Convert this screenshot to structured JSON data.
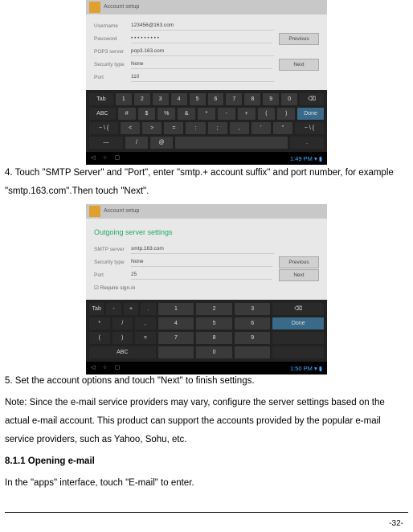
{
  "shot1": {
    "title": "Account setup",
    "labels": {
      "u": "Username",
      "p": "Password",
      "s": "POP3 server",
      "t": "Security type",
      "pt": "Port"
    },
    "vals": {
      "u": "123456@163.com",
      "p": "• • • • • • • • •",
      "s": "pop3.163.com",
      "t": "None",
      "pt": "110"
    },
    "btns": {
      "prev": "Previous",
      "next": "Next"
    },
    "kbd": {
      "r1": [
        "Tab",
        "1",
        "2",
        "3",
        "4",
        "5",
        "6",
        "7",
        "8",
        "9",
        "0",
        "⌫"
      ],
      "r2": [
        "ABC",
        "#",
        "$",
        "%",
        "&",
        "*",
        "-",
        "+",
        "(",
        ")",
        "Done"
      ],
      "r3": [
        "~ \\ {",
        "<",
        ">",
        "=",
        ":",
        ";",
        ",",
        "'",
        "\"",
        "~ \\ {"
      ],
      "r4": [
        "/",
        "@"
      ]
    },
    "time": "1:49 PM ▾ ▮"
  },
  "shot2": {
    "title": "Account setup",
    "heading": "Outgoing server settings",
    "labels": {
      "s": "SMTP server",
      "t": "Security type",
      "pt": "Port"
    },
    "vals": {
      "s": "smtp.163.com",
      "t": "None",
      "pt": "25"
    },
    "btns": {
      "prev": "Previous",
      "next": "Next"
    },
    "chk": "Require sign-in",
    "kbd": {
      "left": [
        [
          "Tab",
          "-",
          "+",
          "."
        ],
        [
          "*",
          "/",
          ","
        ],
        [
          "(",
          ")",
          "="
        ],
        "ABC"
      ],
      "mid": [
        [
          "1",
          "2",
          "3"
        ],
        [
          "4",
          "5",
          "6"
        ],
        [
          "7",
          "8",
          "9"
        ],
        [
          "",
          "0",
          ""
        ]
      ],
      "right": [
        "⌫",
        "Done",
        "",
        ""
      ]
    },
    "time": "1:50 PM ▾ ▮"
  },
  "text": {
    "p1": "4. Touch \"SMTP Server\" and \"Port\", enter \"smtp.+ account suffix\" and port number, for example \"smtp.163.com\".Then touch \"Next\".",
    "p2": "5. Set the account options and touch \"Next\" to finish settings.",
    "p3": "Note: Since the e-mail service providers may vary, configure the server settings based on the actual e-mail account. This product can support the accounts provided by the popular e-mail service providers, such as Yahoo, Sohu, etc.",
    "h": "8.1.1 Opening e-mail",
    "p4": "In the \"apps\" interface, touch \"E-mail\" to enter.",
    "pg": "-32-"
  }
}
